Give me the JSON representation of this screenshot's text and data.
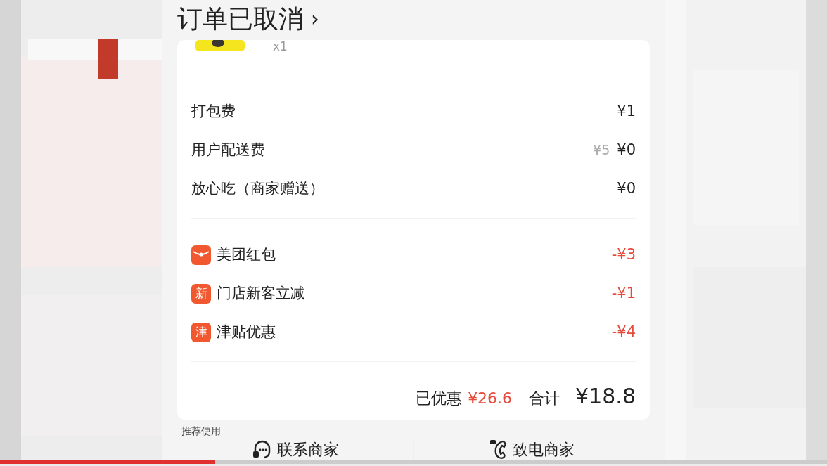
{
  "header": {
    "title": "订单已取消",
    "chevron": "›"
  },
  "product": {
    "quantity": "x1"
  },
  "fees": [
    {
      "label": "打包费",
      "amount": "¥1"
    },
    {
      "label": "用户配送费",
      "original": "¥5",
      "amount": "¥0"
    },
    {
      "label": "放心吃（商家赠送）",
      "amount": "¥0"
    }
  ],
  "discounts": [
    {
      "kind": "envelope",
      "label": "美团红包",
      "amount": "-¥3"
    },
    {
      "kind": "badge",
      "badge": "新",
      "label": "门店新客立减",
      "amount": "-¥1"
    },
    {
      "kind": "badge",
      "badge": "津",
      "label": "津贴优惠",
      "amount": "-¥4"
    }
  ],
  "summary": {
    "saved_label": "已优惠",
    "saved": "¥26.6",
    "total_label": "合计",
    "total": "¥18.8"
  },
  "recommend_label": "推荐使用",
  "actions": [
    {
      "kind": "chat",
      "label": "联系商家"
    },
    {
      "kind": "phone",
      "label": "致电商家"
    }
  ],
  "video_progress": {
    "level": 0.26
  }
}
